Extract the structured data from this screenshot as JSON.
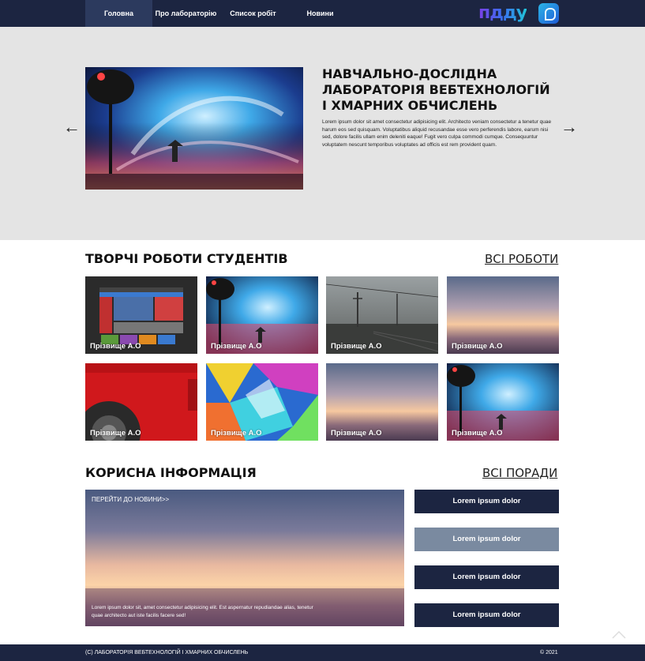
{
  "nav": {
    "items": [
      "Головна",
      "Про лабораторію",
      "Список робіт",
      "Новини"
    ],
    "logo_text": "пдду"
  },
  "hero": {
    "title": "НАВЧАЛЬНО-ДОСЛІДНА ЛАБОРАТОРІЯ ВЕБТЕХНОЛОГІЙ І ХМАРНИХ ОБЧИСЛЕНЬ",
    "text": "Lorem ipsum dolor sit amet consectetur adipisicing elit. Architecto veniam consectetur a tenetur quae harum eos sed quisquam. Voluptatibus aliquid recusandae esse vero perferendis labore, earum nisi sed, dolore facilis ullam enim deleniti eaque! Fugit vero culpa commodi cumque. Consequuntur voluptatem nescunt temporibus voluptates ad officis est rem provident quam.",
    "prev_arrow": "←",
    "next_arrow": "→"
  },
  "works": {
    "title": "ТВОРЧІ РОБОТИ СТУДЕНТІВ",
    "all_link": "ВСІ РОБОТИ",
    "cards": [
      {
        "label": "Прізвище А.О",
        "image": "website-screenshot"
      },
      {
        "label": "Прізвище А.О",
        "image": "umbrella-painting"
      },
      {
        "label": "Прізвище А.О",
        "image": "foggy-railway"
      },
      {
        "label": "Прізвище А.О",
        "image": "sunset-sky"
      },
      {
        "label": "Прізвище А.О",
        "image": "red-car"
      },
      {
        "label": "Прізвище А.О",
        "image": "abstract-colors"
      },
      {
        "label": "Прізвище А.О",
        "image": "sunset-sky"
      },
      {
        "label": "Прізвище А.О",
        "image": "umbrella-painting"
      }
    ]
  },
  "info": {
    "title": "КОРИСНА ІНФОРМАЦІЯ",
    "all_link": "ВСІ ПОРАДИ",
    "news_link": "ПЕРЕЙТИ ДО НОВИНИ>>",
    "text": "Lorem ipsum dolor sit, amet consectetur adipisicing elit. Est aspernatur repudiandae alias, tenetur quae architecto aut iste facilis facere sed!",
    "buttons": [
      "Lorem ipsum dolor",
      "Lorem ipsum dolor",
      "Lorem ipsum dolor",
      "Lorem ipsum dolor"
    ]
  },
  "footer": {
    "left": "(C) ЛАБОРАТОРІЯ ВЕБТЕХНОЛОГІЙ І ХМАРНИХ ОБЧИСЛЕНЬ",
    "right": "© 2021"
  },
  "colors": {
    "nav_bg": "#1c2541",
    "hero_bg": "#e4e4e4",
    "button_dark": "#1c2541",
    "button_light": "#7a8aa0"
  }
}
